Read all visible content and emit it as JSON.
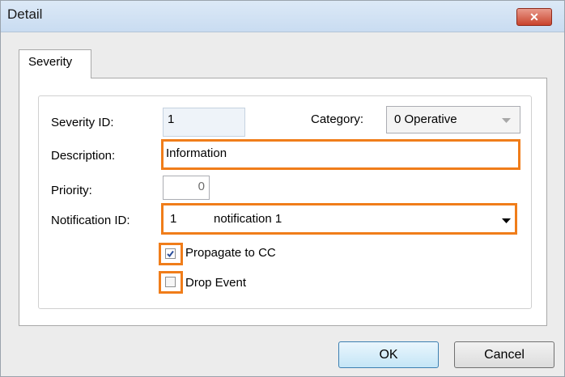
{
  "window": {
    "title": "Detail",
    "close_glyph": "✕"
  },
  "tabs": [
    {
      "label": "Severity",
      "active": true
    }
  ],
  "form": {
    "severity_id": {
      "label": "Severity ID:",
      "value": "1"
    },
    "category": {
      "label": "Category:",
      "value": "0 Operative"
    },
    "description": {
      "label": "Description:",
      "value": "Information"
    },
    "priority": {
      "label": "Priority:",
      "value": "0"
    },
    "notification_id": {
      "label": "Notification ID:",
      "id_value": "1",
      "name_value": "notification 1"
    },
    "propagate_to_cc": {
      "label": "Propagate to CC",
      "checked": true
    },
    "drop_event": {
      "label": "Drop Event",
      "checked": false
    }
  },
  "buttons": {
    "ok": "OK",
    "cancel": "Cancel"
  },
  "colors": {
    "highlight": "#f07d1a",
    "checkbox_check": "#2b4e9a"
  }
}
